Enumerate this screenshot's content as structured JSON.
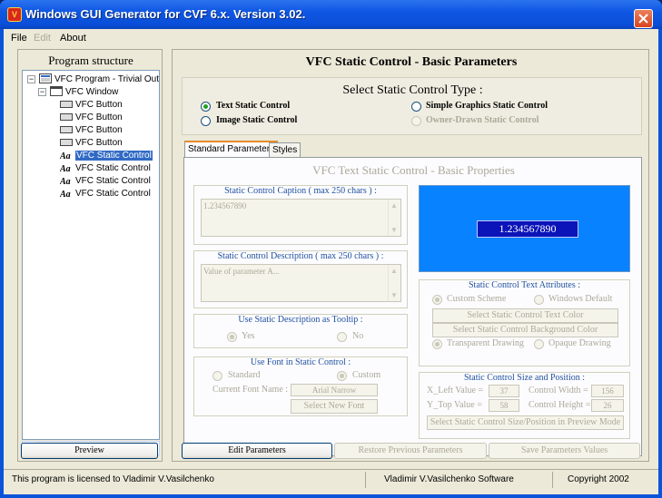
{
  "window": {
    "title": "Windows GUI Generator for CVF 6.x. Version 3.02."
  },
  "menu": {
    "file": "File",
    "edit": "Edit",
    "about": "About"
  },
  "left_panel": {
    "title": "Program structure",
    "tree": [
      {
        "label": "VFC Program - Trivial Output",
        "icon": "program-icon"
      },
      {
        "label": "VFC Window",
        "icon": "window-icon"
      },
      {
        "label": "VFC Button",
        "icon": "button-icon"
      },
      {
        "label": "VFC Button",
        "icon": "button-icon"
      },
      {
        "label": "VFC Button",
        "icon": "button-icon"
      },
      {
        "label": "VFC Button",
        "icon": "button-icon"
      },
      {
        "label": "VFC Static Control",
        "icon": "static-text-icon",
        "selected": true
      },
      {
        "label": "VFC Static Control",
        "icon": "static-text-icon"
      },
      {
        "label": "VFC Static Control",
        "icon": "static-text-icon"
      },
      {
        "label": "VFC Static Control",
        "icon": "static-text-icon"
      }
    ],
    "preview_button": "Preview"
  },
  "right_panel": {
    "title": "VFC Static Control - Basic Parameters",
    "type_select": {
      "title": "Select Static Control Type :",
      "options": [
        {
          "label": "Text Static Control",
          "checked": true,
          "enabled": true
        },
        {
          "label": "Simple Graphics Static Control",
          "checked": false,
          "enabled": true
        },
        {
          "label": "Image Static Control",
          "checked": false,
          "enabled": true
        },
        {
          "label": "Owner-Drawn Static Control",
          "checked": false,
          "enabled": false
        }
      ]
    },
    "tabs": [
      "Standard Parameters",
      "Styles"
    ],
    "inner_title": "VFC Text Static Control - Basic Properties",
    "caption": {
      "title": "Static Control Caption ( max 250 chars ) :",
      "value": "1.234567890"
    },
    "description": {
      "title": "Static Control Description ( max 250 chars ) :",
      "value": "Value of parameter A..."
    },
    "tooltip": {
      "title": "Use Static Description as Tooltip :",
      "yes": "Yes",
      "no": "No"
    },
    "font": {
      "title": "Use Font in Static Control :",
      "standard": "Standard",
      "custom": "Custom",
      "current_label": "Current Font Name :",
      "current_value": "Arial Narrow",
      "select_button": "Select New Font"
    },
    "preview_text": "1.234567890",
    "text_attributes": {
      "title": "Static Control Text Attributes :",
      "custom_scheme": "Custom Scheme",
      "windows_default": "Windows Default",
      "text_color_button": "Select Static Control Text Color",
      "bg_color_button": "Select Static Control Background Color",
      "transparent": "Transparent Drawing",
      "opaque": "Opaque Drawing"
    },
    "size_position": {
      "title": "Static Control Size and Position :",
      "x_left_label": "X_Left Value =",
      "x_left": "37",
      "width_label": "Control Width =",
      "width": "156",
      "y_top_label": "Y_Top Value =",
      "y_top": "58",
      "height_label": "Control Height =",
      "height": "26",
      "preview_button": "Select Static Control Size/Position in Preview Mode"
    },
    "buttons": {
      "edit": "Edit Parameters",
      "restore": "Restore Previous Parameters",
      "save": "Save Parameters Values"
    }
  },
  "status_bar": {
    "license": "This program is licensed to Vladimir V.Vasilchenko",
    "vendor": "Vladimir V.Vasilchenko Software",
    "copyright": "Copyright 2002"
  },
  "colors": {
    "preview_bg": "#0882ff",
    "preview_label_bg": "#0b14b8",
    "selection": "#316ac5"
  }
}
